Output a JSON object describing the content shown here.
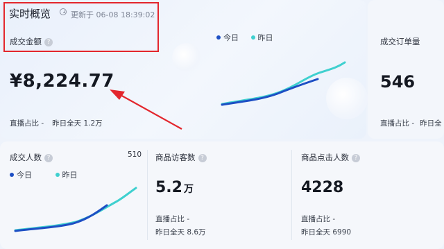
{
  "header": {
    "title": "实时概览",
    "updated_text": "更新于 06-08 18:39:02"
  },
  "colors": {
    "today": "#1d4fc4",
    "yesterday": "#3fd0cf",
    "accent_red": "#e3262d"
  },
  "metrics": {
    "gmv": {
      "label": "成交金额",
      "value": "¥8,224.77",
      "live_ratio": "直播占比 -",
      "yesterday_full": "昨日全天 1.2万"
    },
    "orders": {
      "label": "成交订单量",
      "value": "546",
      "live_ratio": "直播占比 -",
      "yesterday_full": "昨日全"
    },
    "buyers": {
      "label": "成交人数",
      "value": "510"
    },
    "visitors": {
      "label": "商品访客数",
      "value": "5.2",
      "unit": "万",
      "live_ratio": "直播占比 -",
      "yesterday_full": "昨日全天 8.6万"
    },
    "clicks": {
      "label": "商品点击人数",
      "value": "4228",
      "live_ratio": "直播占比 -",
      "yesterday_full": "昨日全天 6990"
    }
  },
  "legend": {
    "today": "今日",
    "yesterday": "昨日"
  },
  "icons": {
    "help": "question-icon",
    "clock": "clock-icon",
    "annotation": "red-arrow"
  }
}
